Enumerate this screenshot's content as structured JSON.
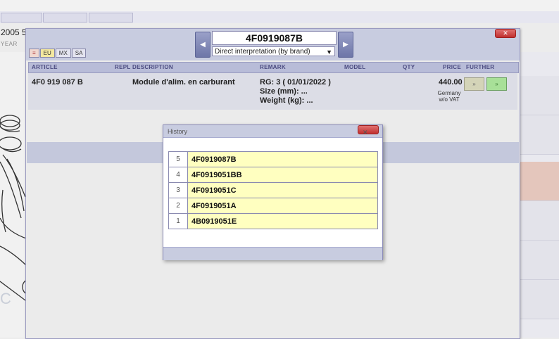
{
  "background": {
    "year_value": "2005",
    "year_suffix": "5",
    "year_label": "YEAR",
    "watermark": "C"
  },
  "main_window": {
    "part_number": "4F0919087B",
    "interpretation": "Direct interpretation (by brand)",
    "regions": [
      "≡",
      "EU",
      "MX",
      "SA"
    ],
    "columns": {
      "article": "ARTICLE",
      "repl": "REPL",
      "description": "DESCRIPTION",
      "remark": "REMARK",
      "model": "MODEL",
      "qty": "QTY",
      "price": "PRICE",
      "further": "FURTHER"
    },
    "row": {
      "article": "4F0 919 087 B",
      "description": "Module d'alim. en carburant",
      "remark_line1": "RG: 3 ( 01/01/2022 )",
      "remark_line2": "Size (mm): ...",
      "remark_line3": "Weight (kg): ...",
      "price": "440.00",
      "price_note1": "Germany",
      "price_note2": "w/o VAT",
      "btn1": "»",
      "btn2": "»"
    }
  },
  "history": {
    "title": "History",
    "items": [
      {
        "num": "5",
        "code": "4F0919087B"
      },
      {
        "num": "4",
        "code": "4F0919051BB"
      },
      {
        "num": "3",
        "code": "4F0919051C"
      },
      {
        "num": "2",
        "code": "4F0919051A"
      },
      {
        "num": "1",
        "code": "4B0919051E"
      }
    ]
  }
}
